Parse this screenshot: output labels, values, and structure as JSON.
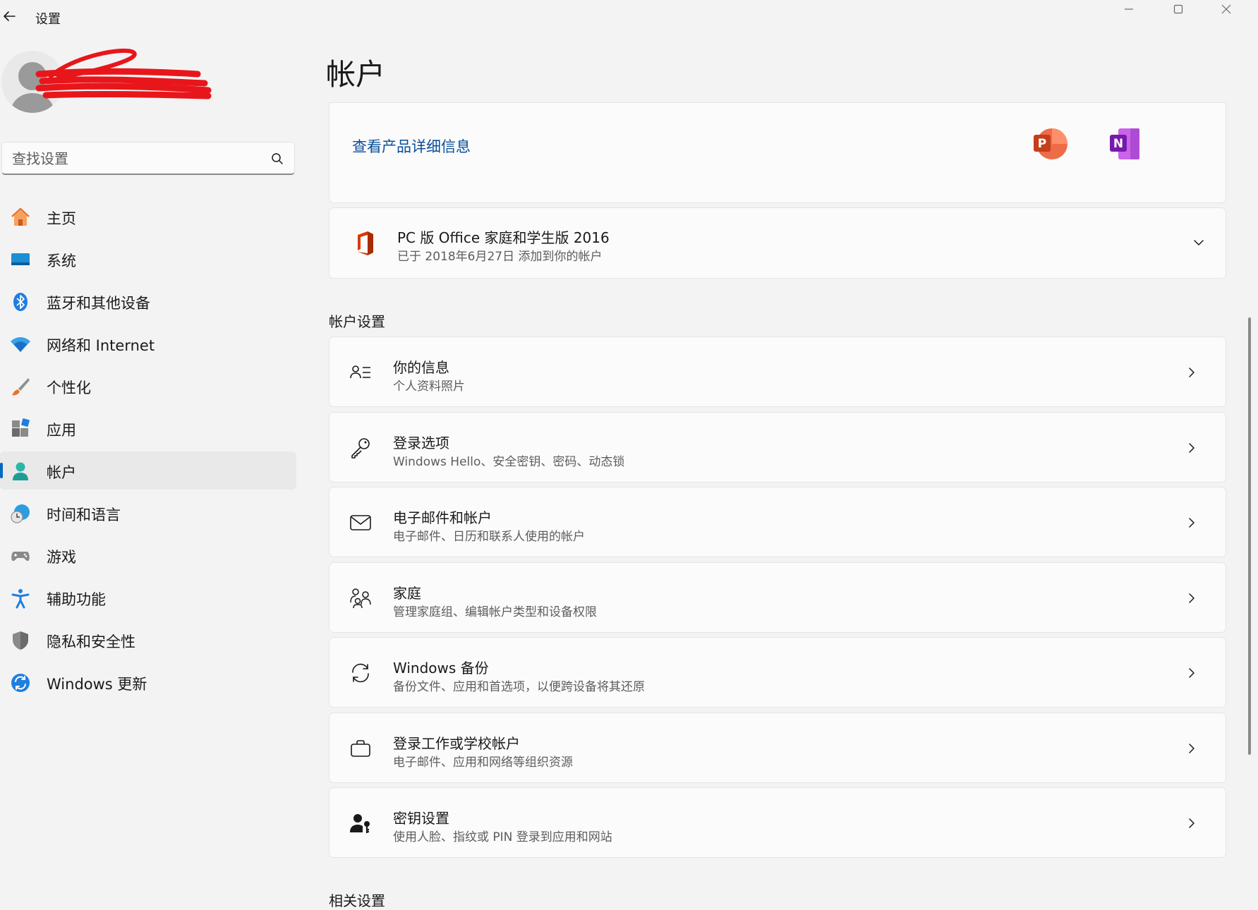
{
  "window": {
    "title": "设置"
  },
  "search": {
    "placeholder": "查找设置"
  },
  "sidebar": {
    "items": [
      {
        "label": "主页",
        "icon": "home-icon"
      },
      {
        "label": "系统",
        "icon": "system-icon"
      },
      {
        "label": "蓝牙和其他设备",
        "icon": "bluetooth-icon"
      },
      {
        "label": "网络和 Internet",
        "icon": "wifi-icon"
      },
      {
        "label": "个性化",
        "icon": "brush-icon"
      },
      {
        "label": "应用",
        "icon": "apps-icon"
      },
      {
        "label": "帐户",
        "icon": "account-icon",
        "active": true
      },
      {
        "label": "时间和语言",
        "icon": "globe-clock-icon"
      },
      {
        "label": "游戏",
        "icon": "gamepad-icon"
      },
      {
        "label": "辅助功能",
        "icon": "accessibility-icon"
      },
      {
        "label": "隐私和安全性",
        "icon": "shield-icon"
      },
      {
        "label": "Windows 更新",
        "icon": "update-icon"
      }
    ]
  },
  "main": {
    "title": "帐户",
    "product_card": {
      "link": "查看产品详细信息",
      "apps": [
        {
          "icon": "powerpoint-icon",
          "letter": "P",
          "color": "#c43e1c"
        },
        {
          "icon": "onenote-icon",
          "letter": "N",
          "color": "#7719aa"
        }
      ]
    },
    "office_card": {
      "title": "PC 版 Office 家庭和学生版 2016",
      "subtitle": "已于 2018年6月27日 添加到你的帐户"
    },
    "account_settings": {
      "heading": "帐户设置",
      "rows": [
        {
          "title": "你的信息",
          "subtitle": "个人资料照片",
          "icon": "person-info-icon"
        },
        {
          "title": "登录选项",
          "subtitle": "Windows Hello、安全密钥、密码、动态锁",
          "icon": "key-icon"
        },
        {
          "title": "电子邮件和帐户",
          "subtitle": "电子邮件、日历和联系人使用的帐户",
          "icon": "mail-icon"
        },
        {
          "title": "家庭",
          "subtitle": "管理家庭组、编辑帐户类型和设备权限",
          "icon": "family-icon"
        },
        {
          "title": "Windows 备份",
          "subtitle": "备份文件、应用和首选项，以便跨设备将其还原",
          "icon": "sync-icon"
        },
        {
          "title": "登录工作或学校帐户",
          "subtitle": "电子邮件、应用和网络等组织资源",
          "icon": "briefcase-icon"
        },
        {
          "title": "密钥设置",
          "subtitle": "使用人脸、指纹或 PIN 登录到应用和网站",
          "icon": "passkey-icon"
        }
      ]
    },
    "related_heading": "相关设置"
  },
  "colors": {
    "accent": "#0067c0",
    "link": "#0a4e9b",
    "background": "#f3f3f3",
    "card": "#fbfbfb"
  }
}
